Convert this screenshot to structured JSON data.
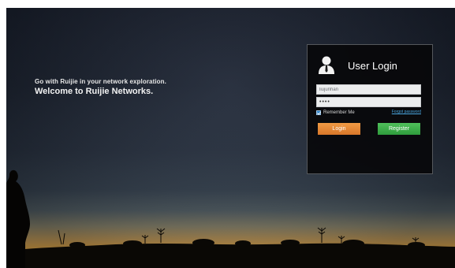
{
  "hero": {
    "tagline": "Go with Ruijie in your network exploration.",
    "welcome": "Welcome to Ruijie Networks."
  },
  "login": {
    "title": "User Login",
    "username_value": "liujunhan",
    "password_value": "••••",
    "remember_label": "Remember Me",
    "remember_checked": true,
    "forgot_label": "Forgot password",
    "login_label": "Login",
    "register_label": "Register"
  },
  "icons": {
    "user": "user-silhouette-icon",
    "checkbox": "checkbox-checked-icon"
  },
  "colors": {
    "login_button": "#e8893a",
    "register_button": "#3fb04c",
    "link": "#4aa7e0",
    "panel_bg": "#08080a"
  }
}
